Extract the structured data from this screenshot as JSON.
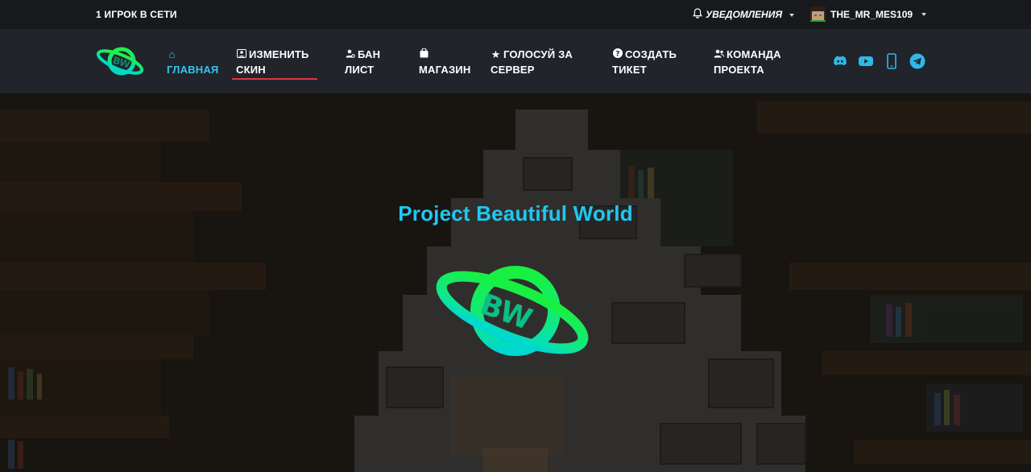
{
  "topbar": {
    "online": "1 ИГРОК В СЕТИ",
    "notifications": "Уведомления",
    "username": "THE_MR_MES109"
  },
  "logo": {
    "text": "BW"
  },
  "nav": [
    {
      "label_line1": "ГЛАВНАЯ",
      "label_line2": "",
      "icon": "home-icon",
      "active": true
    },
    {
      "label_line1": "ИЗМЕНИТЬ",
      "label_line2": "СКИН",
      "icon": "user-box-icon"
    },
    {
      "label_line1": "БАН",
      "label_line2": "ЛИСТ",
      "icon": "user-cog-icon"
    },
    {
      "label_line1": "",
      "label_line2": "МАГАЗИН",
      "icon": "shopping-bag-icon"
    },
    {
      "label_line1": "ГОЛОСУЙ ЗА",
      "label_line2": "СЕРВЕР",
      "icon": "star-icon"
    },
    {
      "label_line1": "СОЗДАТЬ",
      "label_line2": "ТИКЕТ",
      "icon": "question-circle-icon"
    },
    {
      "label_line1": "КОМАНДА",
      "label_line2": "ПРОЕКТА",
      "icon": "users-icon"
    }
  ],
  "socials": [
    "discord-icon",
    "youtube-icon",
    "mobile-icon",
    "telegram-icon"
  ],
  "hero": {
    "title": "Project Beautiful World",
    "logo_text": "BW"
  },
  "colors": {
    "accent": "#33c6f0",
    "underline": "#e0333c",
    "logo_green": "#19f05a",
    "logo_cyan": "#00e0c8"
  }
}
